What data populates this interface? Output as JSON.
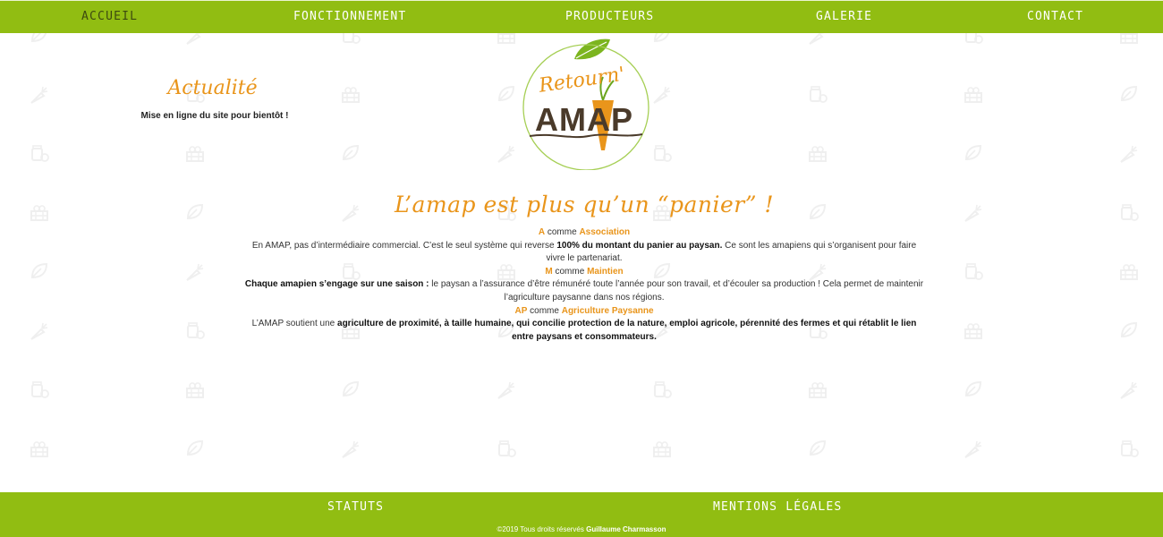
{
  "nav": {
    "items": [
      {
        "label": "ACCUEIL",
        "active": true
      },
      {
        "label": "FONCTIONNEMENT"
      },
      {
        "label": "PRODUCTEURS"
      },
      {
        "label": "GALERIE"
      },
      {
        "label": "CONTACT"
      }
    ]
  },
  "logo": {
    "script_text": "Retourn'",
    "main_text": "AMAP"
  },
  "news": {
    "title": "Actualité",
    "text": "Mise en ligne du site pour bientôt !"
  },
  "main": {
    "headline": "L’amap est plus qu’un “panier” !",
    "a": {
      "letter": "A",
      "comme": " comme ",
      "word": "Association",
      "text1": "En AMAP, pas d’intermédiaire commercial. C’est le seul système qui reverse ",
      "bold": "100% du montant du panier au paysan.",
      "text2": " Ce sont les amapiens qui s’organisent pour faire vivre le partenariat."
    },
    "m": {
      "letter": "M",
      "comme": " comme ",
      "word": "Maintien",
      "bold": "Chaque amapien s’engage sur une saison :",
      "text": " le paysan a l’assurance d’être rémunéré toute l’année pour son travail, et d’écouler sa production ! Cela permet de maintenir l’agriculture paysanne dans nos régions."
    },
    "ap": {
      "letter": "AP",
      "comme": " comme ",
      "word": "Agriculture Paysanne",
      "text": "L’AMAP soutient une ",
      "bold": "agriculture de proximité, à taille humaine, qui concilie protection de la nature, emploi agricole, pérennité des fermes et qui rétablit le lien entre paysans et consommateurs."
    }
  },
  "footer": {
    "links": [
      "STATUTS",
      "MENTIONS LÉGALES"
    ],
    "copyright_text": "©2019 Tous droits réservés ",
    "copyright_author": "Guillaume Charmasson"
  },
  "colors": {
    "brand_green": "#91bd12",
    "accent_orange": "#e9951b",
    "active_nav": "#3d4a10"
  },
  "icons": {
    "pattern": [
      "leaf-icon",
      "carrot-icon",
      "jar-icon",
      "crate-icon"
    ]
  }
}
